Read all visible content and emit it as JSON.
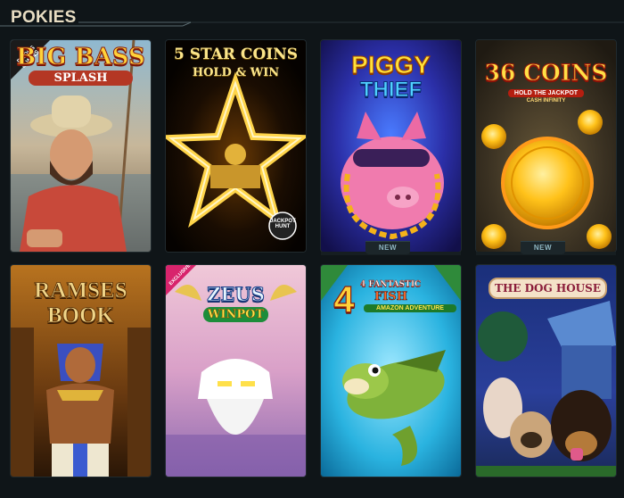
{
  "section": {
    "title": "POKIES"
  },
  "games": [
    {
      "title_line1": "BIG BASS",
      "title_line2": "SPLASH",
      "corner_tag_line1": "DROPS",
      "corner_tag_line2": "& WINS",
      "badge": ""
    },
    {
      "title_line1": "5 STAR COINS",
      "title_line2": "HOLD & WIN",
      "corner_logo_line1": "JACKPOT",
      "corner_logo_line2": "HUNT",
      "badge": ""
    },
    {
      "title_line1": "PIGGY",
      "title_line2": "THIEF",
      "badge": "NEW"
    },
    {
      "title_line1": "36 COINS",
      "title_line2": "HOLD THE JACKPOT",
      "title_line3": "CASH INFINITY",
      "badge": "NEW"
    },
    {
      "title_line1": "RAMSES",
      "title_line2": "BOOK",
      "badge": ""
    },
    {
      "title_line1": "ZEUS",
      "title_line2": "WINPOT",
      "corner_tag_line1": "EXCLUSIVE",
      "badge": ""
    },
    {
      "title_line1": "4 FANTASTIC",
      "title_line2": "FISH",
      "title_line3": "AMAZON ADVENTURE",
      "badge": ""
    },
    {
      "title_line1": "THE DOG HOUSE",
      "badge": ""
    }
  ]
}
